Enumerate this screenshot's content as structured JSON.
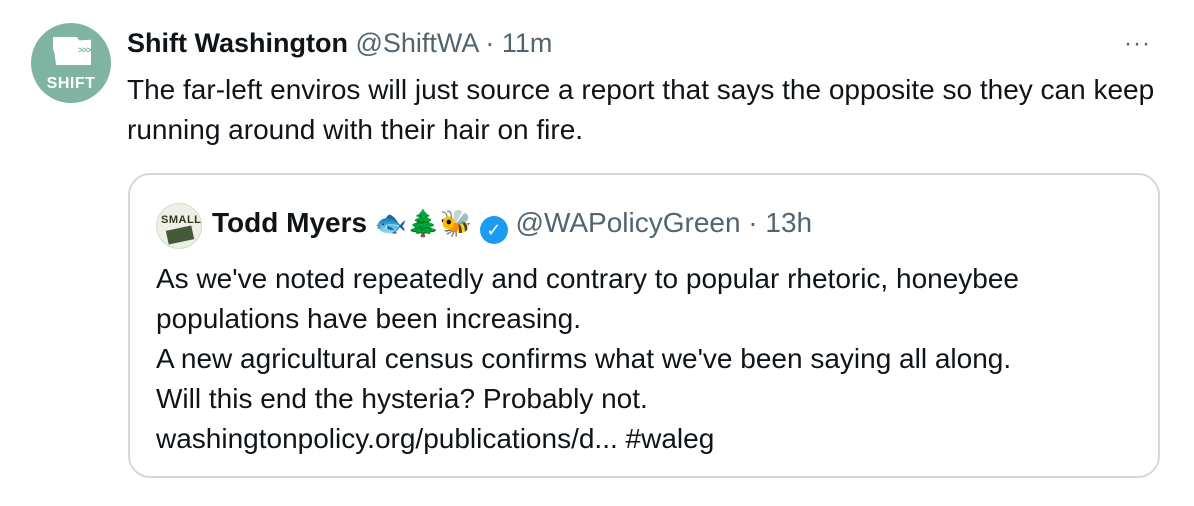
{
  "tweet": {
    "avatar_label": "SHIFT",
    "avatar_arrows": ">>>>",
    "author_name": "Shift Washington",
    "author_meta": " @ShiftWA · 11m",
    "more_label": "···",
    "text": "The far-left enviros will just source a report that says the opposite so they can keep running around with their hair on fire."
  },
  "quoted_tweet": {
    "avatar_label": "SMALL",
    "author_name": "Todd Myers",
    "emoji_fish": "🐟",
    "emoji_tree": "🌲",
    "emoji_bee": "🐝",
    "verified_mark": "✓",
    "author_meta": "@WAPolicyGreen · 13h",
    "lines": [
      "As we've noted repeatedly and contrary to popular rhetoric, honeybee",
      "populations have been increasing.",
      "A new agricultural census confirms what we've been saying all along.",
      "Will this end the hysteria? Probably not.",
      "washingtonpolicy.org/publications/d... #waleg"
    ]
  }
}
